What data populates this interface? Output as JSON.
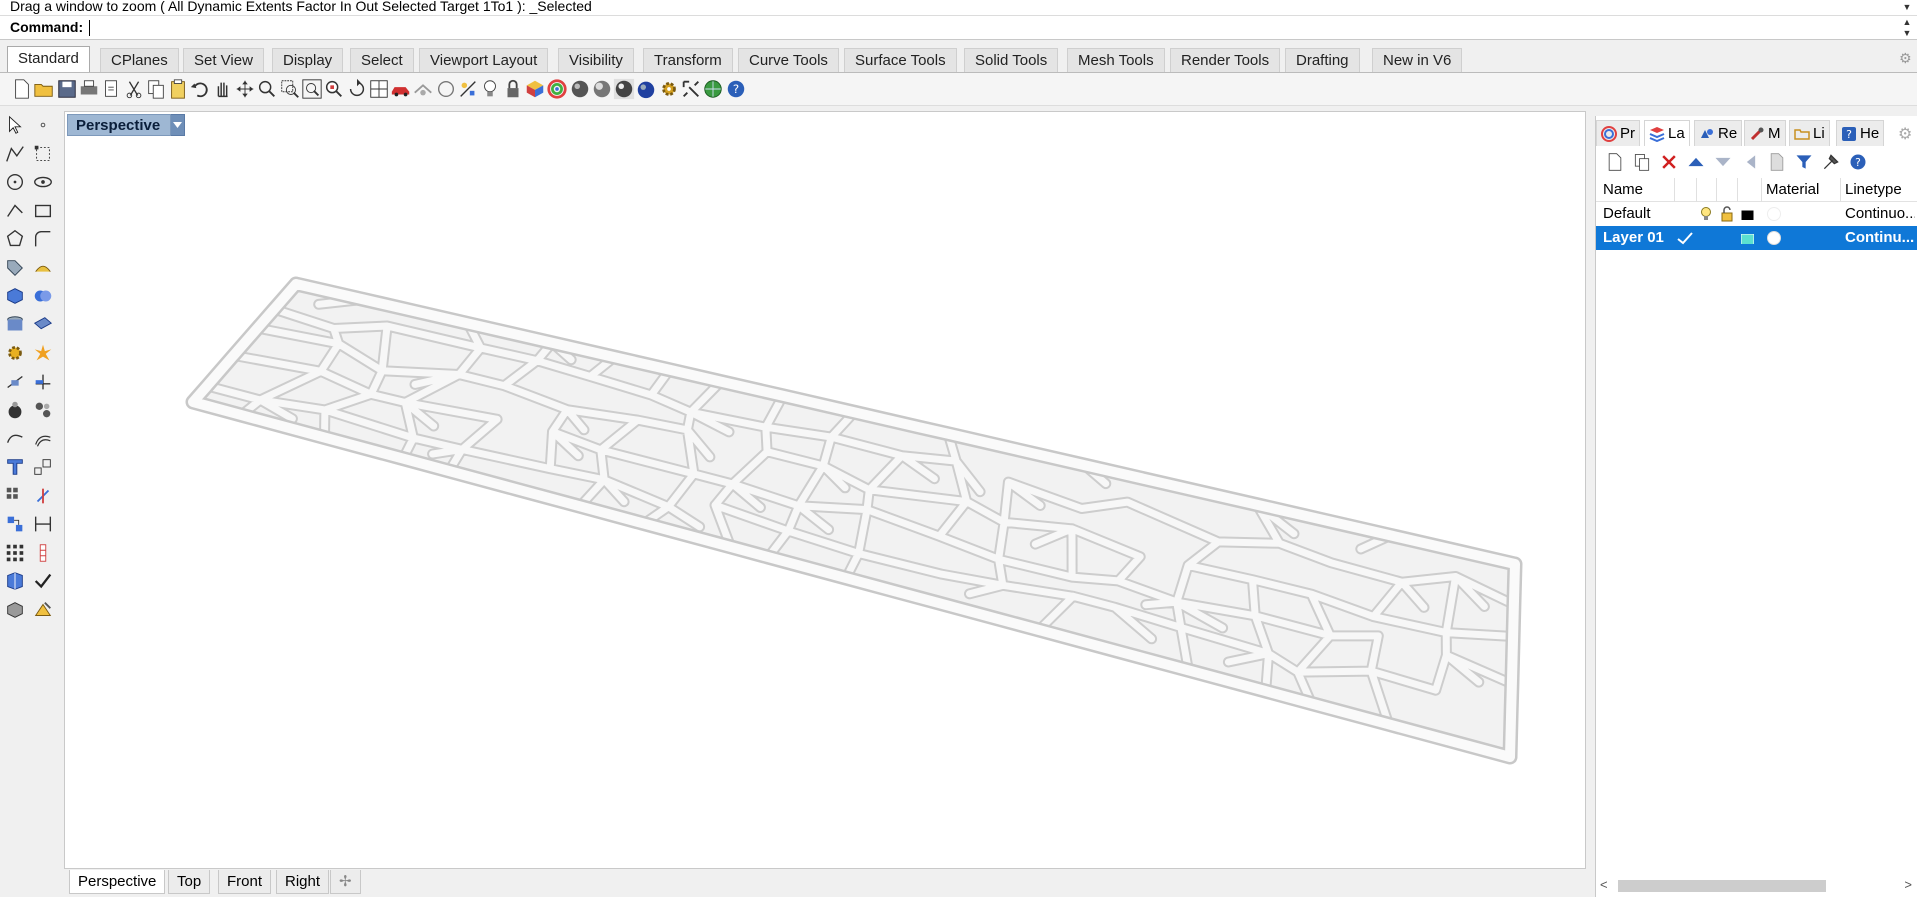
{
  "command": {
    "history": "Drag a window to zoom ( All  Dynamic  Extents  Factor  In  Out  Selected  Target  1To1 ): _Selected",
    "prompt_label": "Command:",
    "input_value": ""
  },
  "toolbar_tabs": [
    {
      "label": "Standard",
      "active": true
    },
    {
      "label": "CPlanes"
    },
    {
      "label": "Set View"
    },
    {
      "label": "Display"
    },
    {
      "label": "Select"
    },
    {
      "label": "Viewport Layout"
    },
    {
      "label": "Visibility"
    },
    {
      "label": "Transform"
    },
    {
      "label": "Curve Tools"
    },
    {
      "label": "Surface Tools"
    },
    {
      "label": "Solid Tools"
    },
    {
      "label": "Mesh Tools"
    },
    {
      "label": "Render Tools"
    },
    {
      "label": "Drafting"
    },
    {
      "label": "New in V6"
    }
  ],
  "toolbar_icons": [
    "new-file-icon",
    "open-folder-icon",
    "save-icon",
    "print-icon",
    "import-icon",
    "cut-icon",
    "copy-icon",
    "paste-icon",
    "undo-icon",
    "pan-hand-icon",
    "rotate-view-icon",
    "zoom-icon",
    "zoom-window-icon",
    "zoom-extents-icon",
    "zoom-selected-icon",
    "undo-view-icon",
    "four-viewports-icon",
    "car-icon",
    "options-icon",
    "circle-icon",
    "select-points-icon",
    "light-bulb-icon",
    "lock-icon",
    "material-icon",
    "color-wheel-icon",
    "sphere-icon",
    "shaded-sphere-icon",
    "render-sphere-icon",
    "shade-icon",
    "gear-icon",
    "properties-icon",
    "globe-icon",
    "help-icon"
  ],
  "viewport": {
    "title": "Perspective",
    "tabs": [
      {
        "label": "Perspective",
        "active": true
      },
      {
        "label": "Top"
      },
      {
        "label": "Front"
      },
      {
        "label": "Right"
      }
    ]
  },
  "panel": {
    "tabs": [
      {
        "label": "Pr",
        "icon": "properties-icon"
      },
      {
        "label": "La",
        "icon": "layers-icon",
        "active": true
      },
      {
        "label": "Re",
        "icon": "render-icon"
      },
      {
        "label": "M",
        "icon": "materials-icon"
      },
      {
        "label": "Li",
        "icon": "libraries-icon"
      },
      {
        "label": "He",
        "icon": "help-icon"
      }
    ],
    "columns": {
      "name": "Name",
      "material": "Material",
      "linetype": "Linetype"
    },
    "layers": [
      {
        "name": "Default",
        "linetype": "Continuo...",
        "color": "#000000",
        "selected": false
      },
      {
        "name": "Layer 01",
        "linetype": "Continu...",
        "color": "#5ce0d0",
        "selected": true
      }
    ]
  },
  "colors": {
    "selection": "#0f78d7",
    "viewport_title_bg": "#9eb7d3",
    "mesh": "#d4d4d4"
  }
}
